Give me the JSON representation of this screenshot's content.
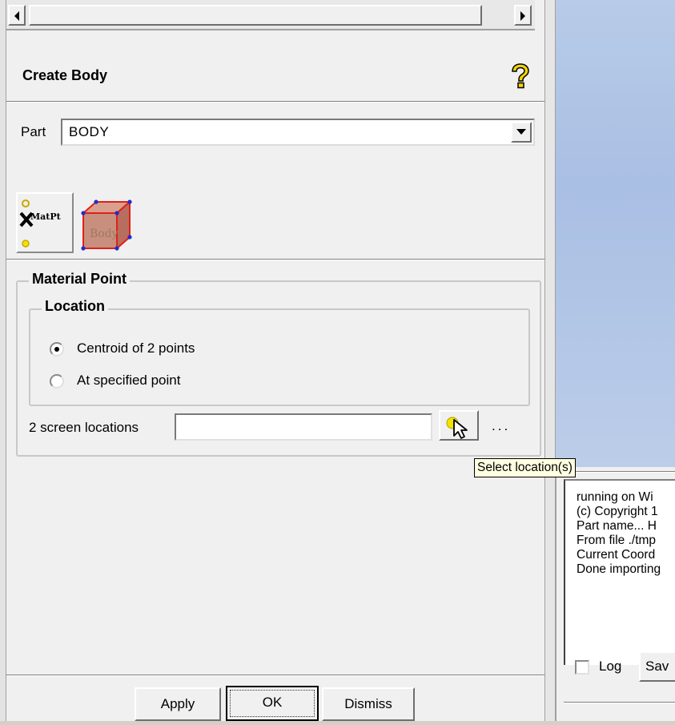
{
  "dialog": {
    "title": "Create Body",
    "part_label": "Part",
    "part_value": "BODY",
    "tools": {
      "material_point_tool_text": "MatPt",
      "body_tool_text": "Body"
    },
    "material_point_group": "Material Point",
    "location_group": "Location",
    "options": [
      {
        "label": "Centroid of 2 points",
        "selected": true
      },
      {
        "label": "At specified point",
        "selected": false
      }
    ],
    "screen_locations_label": "2 screen locations",
    "screen_locations_value": "",
    "more_label": "...",
    "tooltip": "Select location(s)",
    "buttons": {
      "apply": "Apply",
      "ok": "OK",
      "dismiss": "Dismiss"
    }
  },
  "message_window": {
    "lines": [
      "running on Wi",
      "(c) Copyright 1",
      "Part name... H",
      "From file ./tmp",
      "Current Coord",
      "Done importing"
    ],
    "log_label": "Log",
    "save_label": "Sav",
    "log_checked": false
  },
  "colors": {
    "viewport_bg": "#b8cbe8",
    "tooltip_bg": "#ffffe1",
    "dialog_bg": "#f0f0f0"
  }
}
